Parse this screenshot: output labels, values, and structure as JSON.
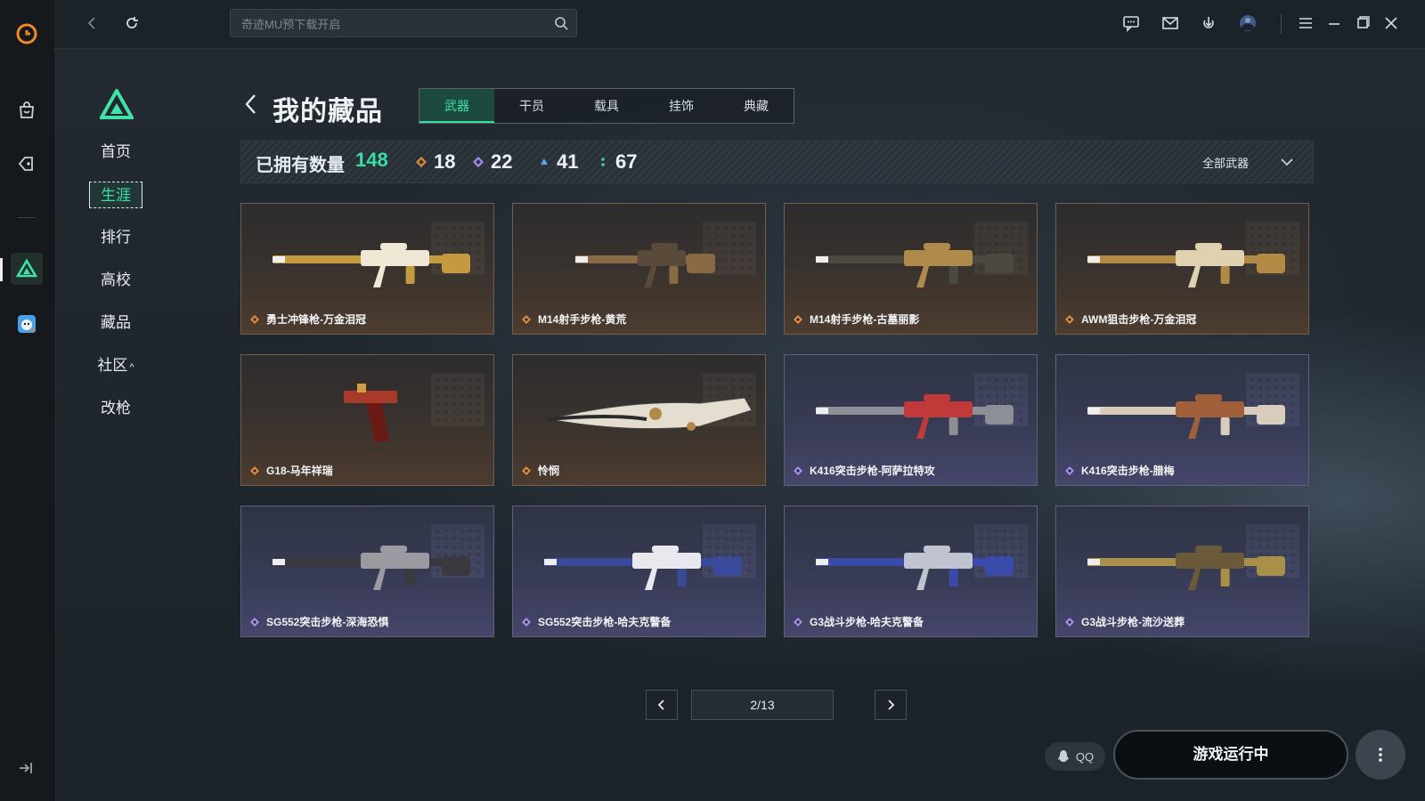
{
  "topbar": {
    "search_placeholder": "奇迹MU预下载开启"
  },
  "sidebar": {
    "items": [
      {
        "label": "首页"
      },
      {
        "label": "生涯"
      },
      {
        "label": "排行"
      },
      {
        "label": "高校"
      },
      {
        "label": "藏品"
      },
      {
        "label": "社区"
      },
      {
        "label": "改枪"
      }
    ],
    "community_caret": "^"
  },
  "main": {
    "title": "我的藏品",
    "tabs": [
      {
        "label": "武器"
      },
      {
        "label": "干员"
      },
      {
        "label": "载具"
      },
      {
        "label": "挂饰"
      },
      {
        "label": "典藏"
      }
    ],
    "owned_label": "已拥有数量",
    "owned_count": "148",
    "rarity_counts": [
      {
        "value": "18",
        "color": "#e08a3c"
      },
      {
        "value": "22",
        "color": "#a98cf0"
      },
      {
        "value": "41",
        "color": "#5ba6e6"
      },
      {
        "value": "67",
        "color": "#39d29b"
      }
    ],
    "filter_label": "全部武器"
  },
  "cards": [
    {
      "name": "勇士冲锋枪-万金泪冠",
      "rarity": "gold"
    },
    {
      "name": "M14射手步枪-黄荒",
      "rarity": "gold"
    },
    {
      "name": "M14射手步枪-古墓丽影",
      "rarity": "gold"
    },
    {
      "name": "AWM狙击步枪-万金泪冠",
      "rarity": "gold"
    },
    {
      "name": "G18-马年祥瑞",
      "rarity": "gold"
    },
    {
      "name": "怜悯",
      "rarity": "gold"
    },
    {
      "name": "K416突击步枪-阿萨拉特攻",
      "rarity": "purple"
    },
    {
      "name": "K416突击步枪-腊梅",
      "rarity": "purple"
    },
    {
      "name": "SG552突击步枪-深海恐惧",
      "rarity": "purple"
    },
    {
      "name": "SG552突击步枪-哈夫克警备",
      "rarity": "purple"
    },
    {
      "name": "G3战斗步枪-哈夫克警备",
      "rarity": "purple"
    },
    {
      "name": "G3战斗步枪-流沙送葬",
      "rarity": "purple"
    }
  ],
  "pager": {
    "text": "2/13"
  },
  "footer": {
    "qq_label": "QQ",
    "run_label": "游戏运行中"
  },
  "colors": {
    "accent": "#38dea2",
    "gold_rarity": "#e08a3c",
    "purple_rarity": "#a98cf0"
  }
}
